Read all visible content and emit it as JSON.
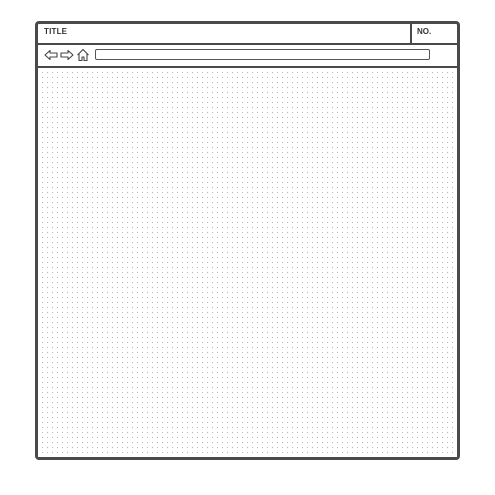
{
  "window": {
    "title": "TITLE",
    "number_label": "NO."
  },
  "navigation": {
    "icons": [
      "back-arrow-icon",
      "forward-arrow-icon",
      "home-icon"
    ],
    "address_value": ""
  }
}
